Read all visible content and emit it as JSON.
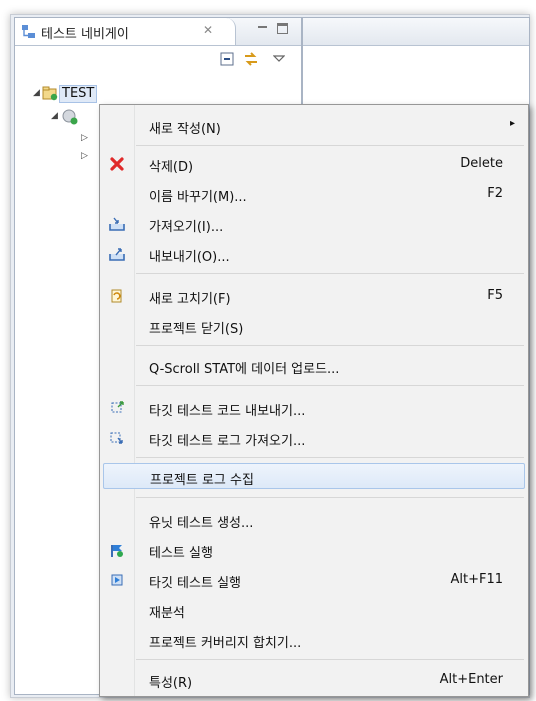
{
  "view": {
    "tab_label": "테스트 네비게이 ",
    "tab_close": "✕"
  },
  "tree": {
    "root_label": "TEST"
  },
  "menu": {
    "items": [
      {
        "label": "새로 작성(N)",
        "shortcut": "",
        "submenu": true
      },
      {
        "label": "삭제(D)",
        "shortcut": "Delete"
      },
      {
        "label": "이름 바꾸기(M)...",
        "shortcut": "F2"
      },
      {
        "label": "가져오기(I)...",
        "shortcut": ""
      },
      {
        "label": "내보내기(O)...",
        "shortcut": ""
      },
      {
        "label": "새로 고치기(F)",
        "shortcut": "F5"
      },
      {
        "label": "프로젝트 닫기(S)",
        "shortcut": ""
      },
      {
        "label": "Q-Scroll STAT에 데이터 업로드...",
        "shortcut": ""
      },
      {
        "label": "타깃 테스트 코드 내보내기...",
        "shortcut": ""
      },
      {
        "label": "타깃 테스트 로그 가져오기...",
        "shortcut": ""
      },
      {
        "label": "프로젝트 로그 수집",
        "shortcut": "",
        "highlighted": true
      },
      {
        "label": "유닛 테스트 생성...",
        "shortcut": ""
      },
      {
        "label": "테스트 실행",
        "shortcut": ""
      },
      {
        "label": "타깃 테스트 실행",
        "shortcut": "Alt+F11"
      },
      {
        "label": "재분석",
        "shortcut": ""
      },
      {
        "label": "프로젝트 커버리지 합치기...",
        "shortcut": ""
      },
      {
        "label": "특성(R)",
        "shortcut": "Alt+Enter"
      }
    ],
    "submenu_arrow": "▸"
  },
  "colors": {
    "highlight": "#dde9f8",
    "delete_icon": "#e02a2a"
  }
}
